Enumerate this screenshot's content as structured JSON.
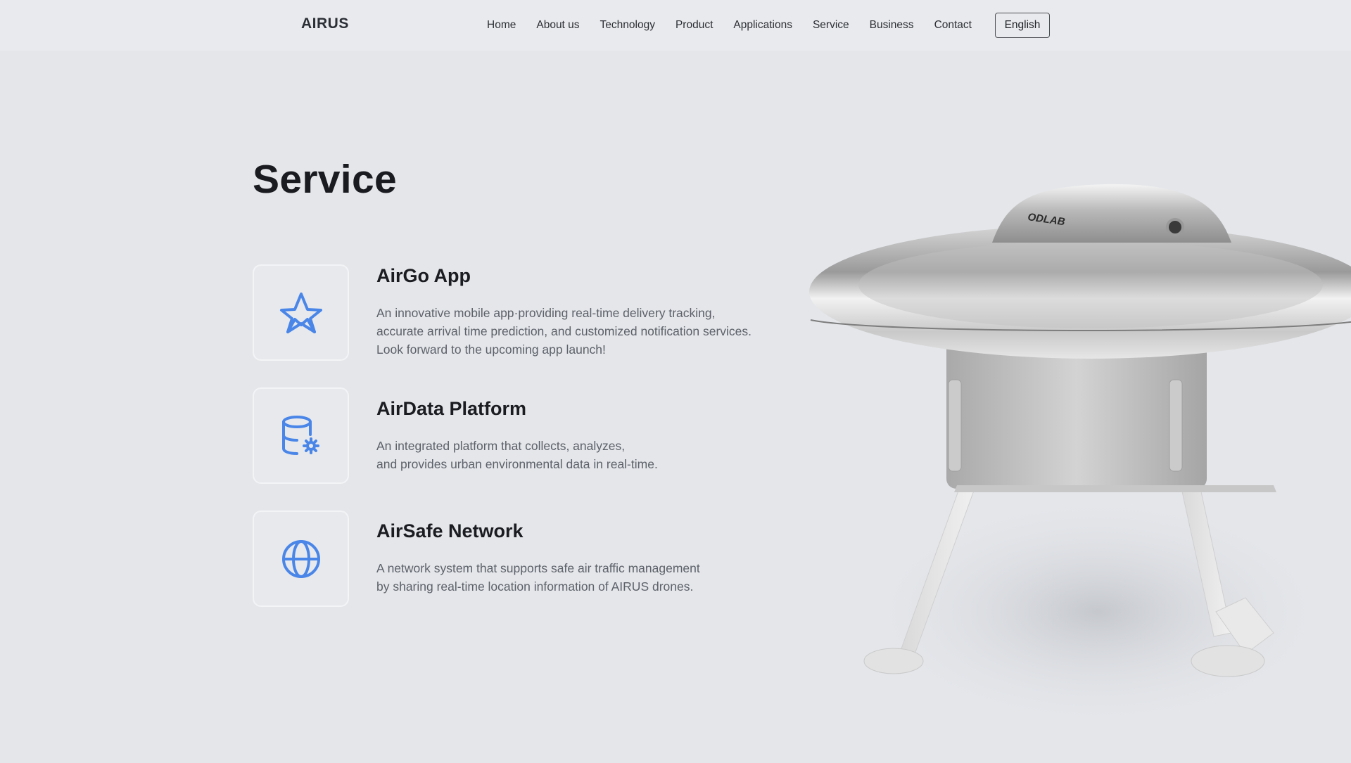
{
  "brand": {
    "logo": "AIRUS"
  },
  "nav": {
    "items": [
      "Home",
      "About us",
      "Technology",
      "Product",
      "Applications",
      "Service",
      "Business",
      "Contact"
    ],
    "language": "English"
  },
  "page": {
    "title": "Service"
  },
  "services": [
    {
      "icon": "star-icon",
      "title": "AirGo App",
      "description": "An innovative mobile app·providing real-time delivery tracking,\naccurate arrival time prediction, and customized notification services.\nLook forward to the  upcoming app launch!"
    },
    {
      "icon": "database-settings-icon",
      "title": "AirData Platform",
      "description": "An integrated platform that collects, analyzes,\nand provides urban environmental data in real-time."
    },
    {
      "icon": "globe-icon",
      "title": "AirSafe Network",
      "description": "A network system that supports safe air traffic management\nby sharing real-time location information of AIRUS drones."
    }
  ],
  "colors": {
    "icon_accent": "#4a86e8",
    "background": "#e4e6ea"
  },
  "hero_image": {
    "label": "ODLAB"
  }
}
